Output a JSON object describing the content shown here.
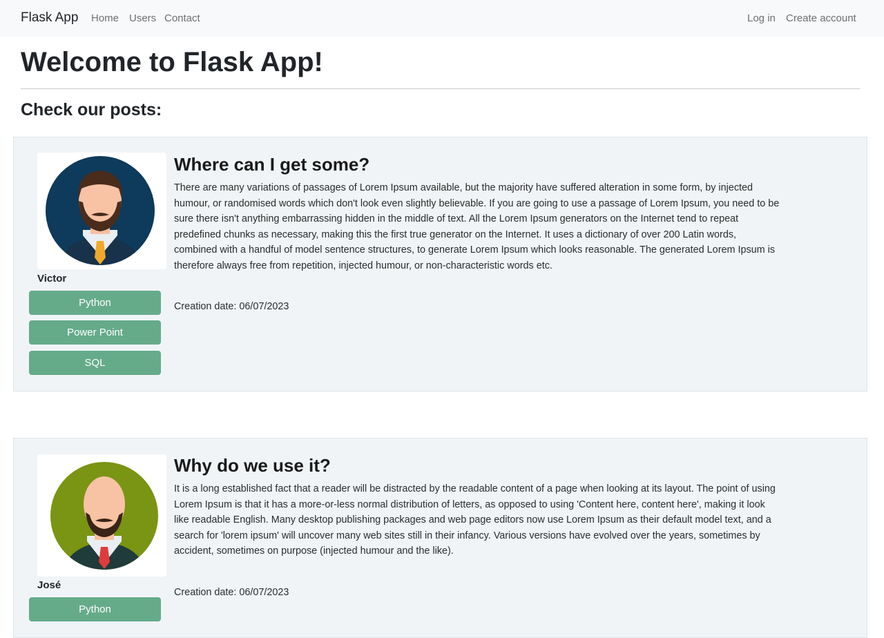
{
  "navbar": {
    "brand": "Flask App",
    "links": [
      "Home",
      "Users",
      "Contact"
    ],
    "right_links": [
      "Log in",
      "Create account"
    ]
  },
  "page": {
    "heading": "Welcome to Flask App!",
    "subheading": "Check our posts:"
  },
  "posts": [
    {
      "title": "Where can I get some?",
      "body": "There are many variations of passages of Lorem Ipsum available, but the majority have suffered alteration in some form, by injected humour, or randomised words which don't look even slightly believable. If you are going to use a passage of Lorem Ipsum, you need to be sure there isn't anything embarrassing hidden in the middle of text. All the Lorem Ipsum generators on the Internet tend to repeat predefined chunks as necessary, making this the first true generator on the Internet. It uses a dictionary of over 200 Latin words, combined with a handful of model sentence structures, to generate Lorem Ipsum which looks reasonable. The generated Lorem Ipsum is therefore always free from repetition, injected humour, or non-characteristic words etc.",
      "date": "Creation date: 06/07/2023",
      "author": "Victor",
      "tags": [
        "Python",
        "Power Point",
        "SQL"
      ],
      "avatar_bg": "#0e3a5b"
    },
    {
      "title": "Why do we use it?",
      "body": "It is a long established fact that a reader will be distracted by the readable content of a page when looking at its layout. The point of using Lorem Ipsum is that it has a more-or-less normal distribution of letters, as opposed to using 'Content here, content here', making it look like readable English. Many desktop publishing packages and web page editors now use Lorem Ipsum as their default model text, and a search for 'lorem ipsum' will uncover many web sites still in their infancy. Various versions have evolved over the years, sometimes by accident, sometimes on purpose (injected humour and the like).",
      "date": "Creation date: 06/07/2023",
      "author": "José",
      "tags": [
        "Python"
      ],
      "avatar_bg": "#7a9413"
    }
  ],
  "colors": {
    "navbar_bg": "#f8f9fa",
    "card_bg": "#f0f4f7",
    "tag_button": "#65ab8a"
  }
}
